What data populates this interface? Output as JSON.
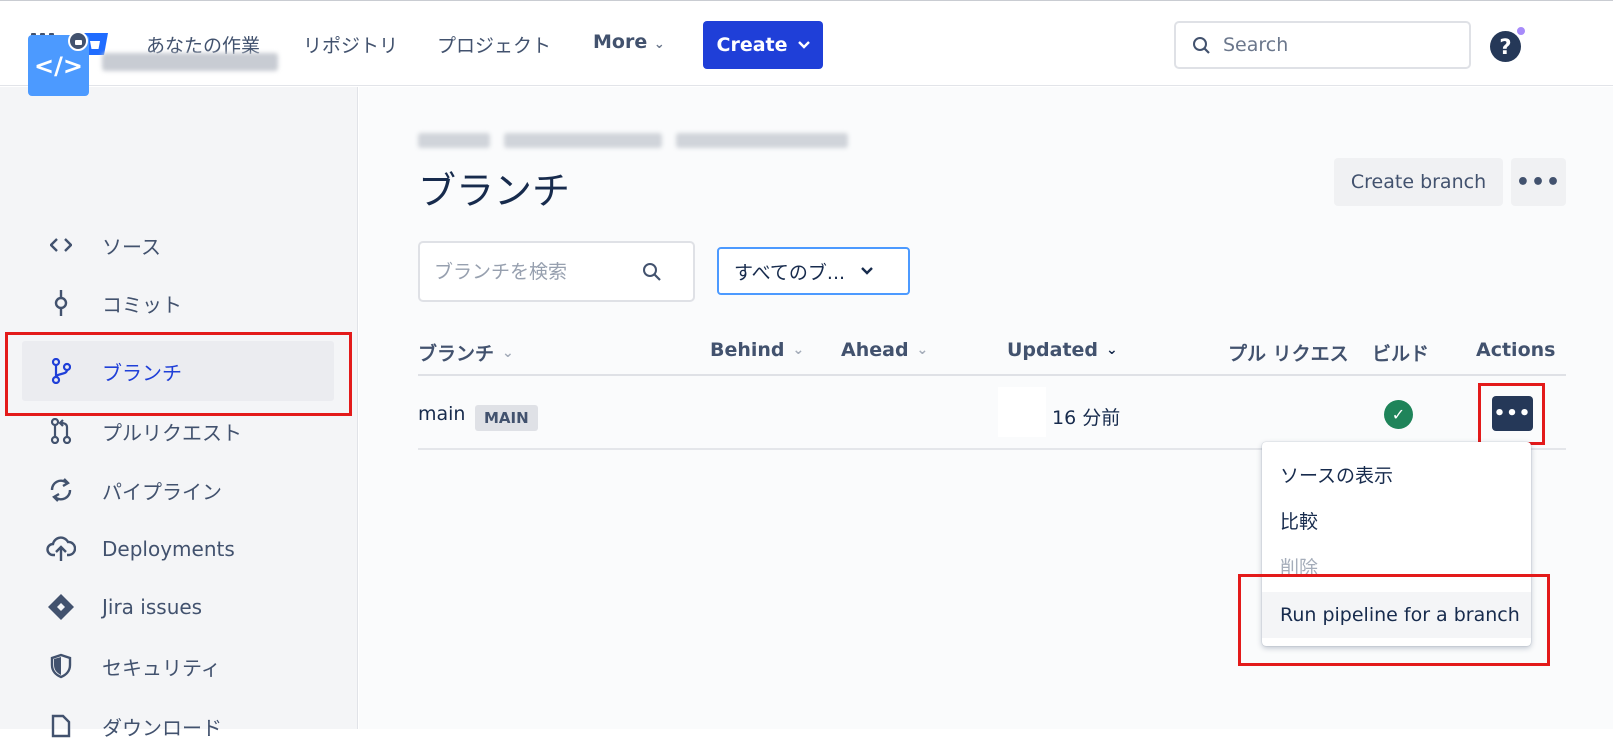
{
  "topbar": {
    "nav": [
      "あなたの作業",
      "リポジトリ",
      "プロジェクト"
    ],
    "more_label": "More",
    "create_label": "Create",
    "search_placeholder": "Search",
    "help_label": "?"
  },
  "sidebar": {
    "items": [
      {
        "label": "ソース",
        "icon": "code-icon"
      },
      {
        "label": "コミット",
        "icon": "commit-icon"
      },
      {
        "label": "ブランチ",
        "icon": "branch-icon",
        "active": true
      },
      {
        "label": "プルリクエスト",
        "icon": "pull-request-icon"
      },
      {
        "label": "パイプライン",
        "icon": "pipeline-icon"
      },
      {
        "label": "Deployments",
        "icon": "cloud-upload-icon"
      },
      {
        "label": "Jira issues",
        "icon": "jira-icon"
      },
      {
        "label": "セキュリティ",
        "icon": "shield-icon"
      },
      {
        "label": "ダウンロード",
        "icon": "download-icon"
      }
    ]
  },
  "page": {
    "title": "ブランチ",
    "create_branch_label": "Create branch",
    "search_placeholder": "ブランチを検索",
    "filter_label": "すべてのブ..."
  },
  "table": {
    "columns": [
      "ブランチ",
      "Behind",
      "Ahead",
      "Updated",
      "プル リクエス",
      "ビルド",
      "Actions"
    ],
    "rows": [
      {
        "branch": "main",
        "badge": "MAIN",
        "updated": "16 分前",
        "build": "success"
      }
    ]
  },
  "menu": {
    "items": [
      {
        "label": "ソースの表示"
      },
      {
        "label": "比較"
      },
      {
        "label": "削除",
        "disabled": true
      },
      {
        "label": "Run pipeline for a branch"
      }
    ]
  },
  "colors": {
    "primary": "#1f3fd8",
    "highlight": "#e31a1a",
    "success": "#1f845a"
  }
}
